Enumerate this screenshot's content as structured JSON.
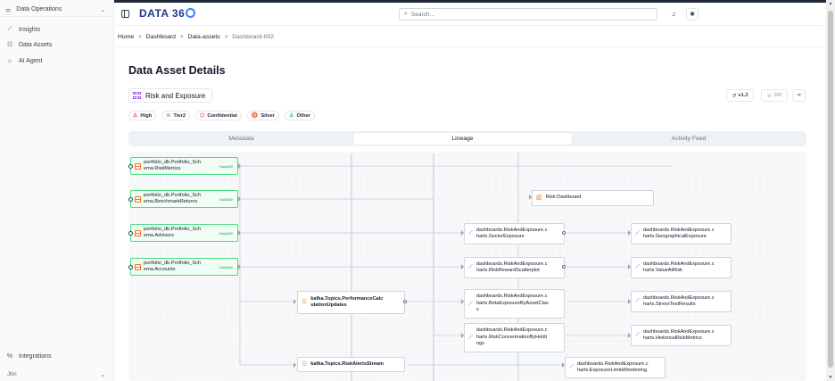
{
  "sidebar": {
    "top_label": "Data Operations",
    "items": [
      {
        "label": "Insights",
        "icon": "chart-line-icon"
      },
      {
        "label": "Data Assets",
        "icon": "database-icon"
      },
      {
        "label": "AI Agent",
        "icon": "robot-icon"
      }
    ],
    "integrations_label": "Integrations",
    "user_label": "Jllm"
  },
  "header": {
    "logo_text": "DATA 36",
    "search_placeholder": "Search..."
  },
  "breadcrumb": [
    "Home",
    "Dashboard",
    "Data-assets",
    "Dashboard-002"
  ],
  "page": {
    "title": "Data Asset Details",
    "asset_name": "Risk and Exposure",
    "tags": [
      {
        "label": "High",
        "icon": "warning-icon",
        "color": "#ef4444"
      },
      {
        "label": "Tier2",
        "icon": "layers-icon",
        "color": "#9ca3af"
      },
      {
        "label": "Confidential",
        "icon": "shield-icon",
        "color": "#ef4444"
      },
      {
        "label": "Silver",
        "icon": "medal-icon",
        "color": "#9ca3af"
      },
      {
        "label": "Other",
        "icon": "user-icon",
        "color": "#22c55e"
      }
    ],
    "version": "v1.2",
    "stars": "388"
  },
  "tabs": [
    "Metadata",
    "Lineage",
    "Activity Feed"
  ],
  "active_tab": "Lineage",
  "lineage": {
    "sources": [
      {
        "name": "portfolio_db.Portfolio_Sch\nema.RiskMetrics",
        "badge": "Data360"
      },
      {
        "name": "portfolio_db.Portfolio_Sch\nema.BenchmarkReturns",
        "badge": "Data360"
      },
      {
        "name": "portfolio_db.Portfolio_Sch\nema.Advisors",
        "badge": "Data360"
      },
      {
        "name": "portfolio_db.Portfolio_Sch\nema.Accounts",
        "badge": "Data360"
      }
    ],
    "topics": [
      "kafka.Topics.PerformanceCalc\nulationUpdates",
      "kafka.Topics.RiskAlertsStream"
    ],
    "dashboard": "Risk Dashboard",
    "charts_mid": [
      "dashboards.RiskAndExposure.c\nharts.SectorExposure",
      "dashboards.RiskAndExposure.c\nharts.RiskRewardScatterplot",
      "dashboards.RiskAndExposure.c\nharts.BetaExposureByAssetClas\ns",
      "dashboards.RiskAndExposure.c\nharts.RiskConcentrationByHoldi\nngs"
    ],
    "charts_right": [
      "dashboards.RiskAndExposure.c\nharts.GeographicalExposure",
      "dashboards.RiskAndExposure.c\nharts.ValueAtRisk",
      "dashboards.RiskAndExposure.c\nharts.StressTestResults",
      "dashboards.RiskAndExposure.c\nharts.HistoricalRiskMetrics"
    ],
    "chart_bottom": "dashboards.RiskAndExposure.c\nharts.ExposureLimitsMonitoring"
  }
}
